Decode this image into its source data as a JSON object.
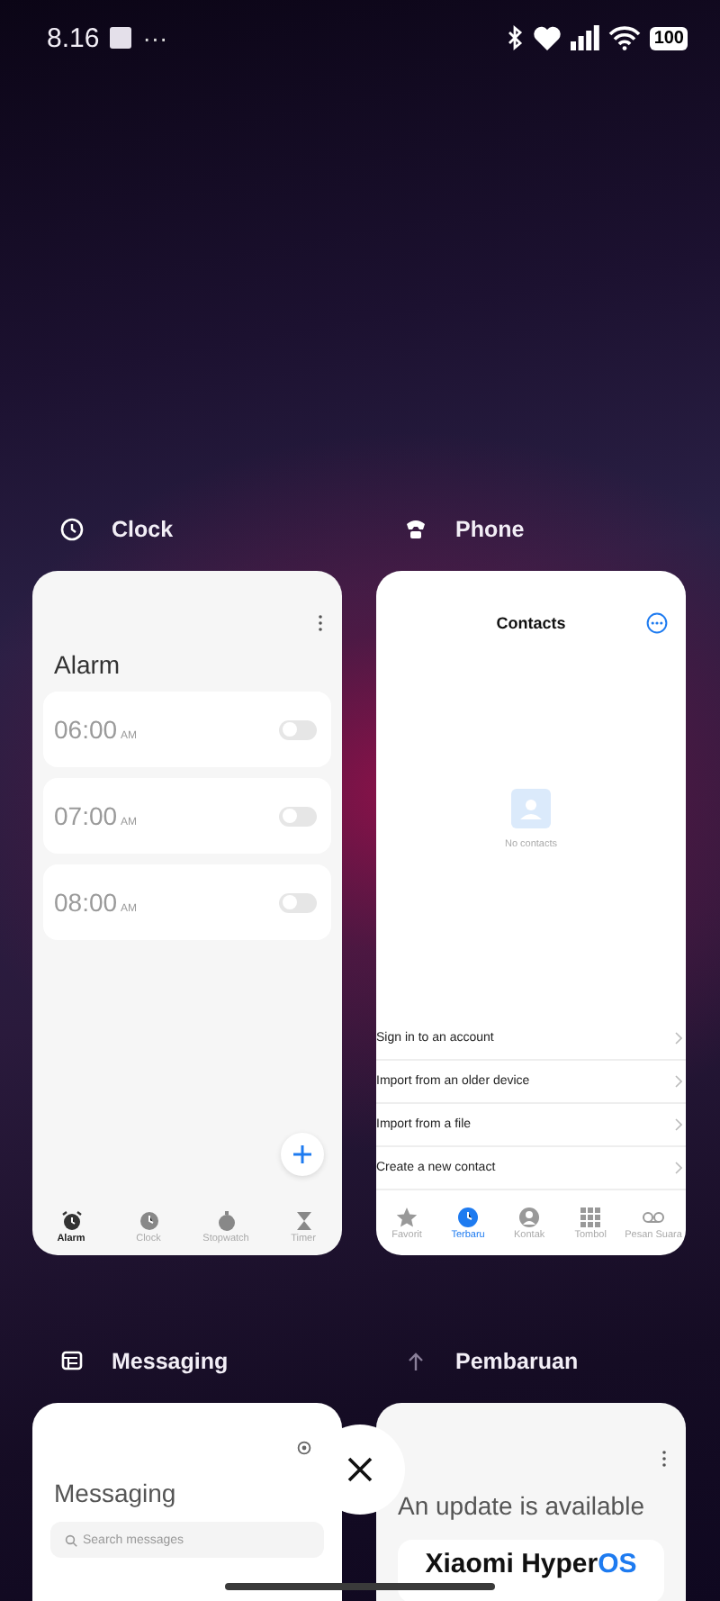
{
  "status_bar": {
    "time": "8.16",
    "more": "···",
    "battery": "100"
  },
  "apps": [
    {
      "kind": "clock",
      "title": "Clock",
      "screen": {
        "heading": "Alarm",
        "alarms": [
          {
            "time": "06:00",
            "period": "AM",
            "on": false
          },
          {
            "time": "07:00",
            "period": "AM",
            "on": false
          },
          {
            "time": "08:00",
            "period": "AM",
            "on": false
          }
        ],
        "nav": [
          {
            "label": "Alarm",
            "selected": true
          },
          {
            "label": "Clock",
            "selected": false
          },
          {
            "label": "Stopwatch",
            "selected": false
          },
          {
            "label": "Timer",
            "selected": false
          }
        ]
      }
    },
    {
      "kind": "phone",
      "title": "Phone",
      "screen": {
        "heading": "Contacts",
        "empty": "No contacts",
        "menu": [
          "Sign in to an account",
          "Import from an older device",
          "Import from a file",
          "Create a new contact"
        ],
        "nav": [
          {
            "label": "Favorit",
            "selected": false
          },
          {
            "label": "Terbaru",
            "selected": true
          },
          {
            "label": "Kontak",
            "selected": false
          },
          {
            "label": "Tombol",
            "selected": false
          },
          {
            "label": "Pesan Suara",
            "selected": false
          }
        ]
      }
    },
    {
      "kind": "messaging",
      "title": "Messaging",
      "screen": {
        "heading": "Messaging",
        "search_placeholder": "Search messages"
      }
    },
    {
      "kind": "update",
      "title": "Pembaruan",
      "screen": {
        "heading": "An update is available",
        "brand": "Xiaomi Hyper",
        "brand_accent": "OS"
      }
    }
  ]
}
